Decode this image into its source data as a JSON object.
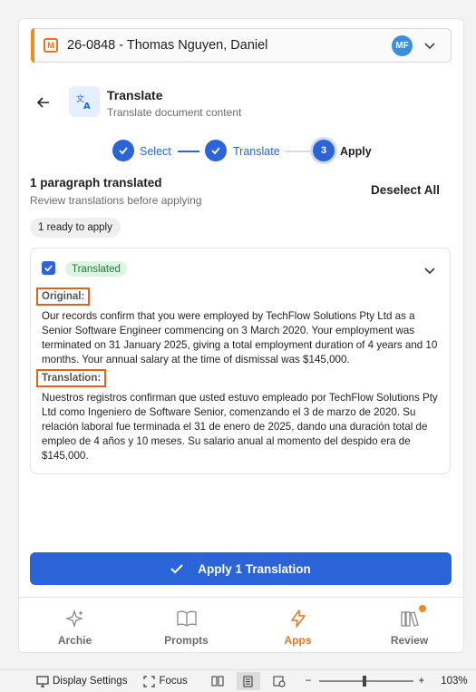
{
  "matter": {
    "title": "26-0848 - Thomas Nguyen, Daniel",
    "avatar_initials": "MF",
    "icon": "matter-icon"
  },
  "header": {
    "title": "Translate",
    "subtitle": "Translate document content"
  },
  "stepper": {
    "steps": [
      {
        "label": "Select"
      },
      {
        "label": "Translate"
      },
      {
        "number": "3",
        "label": "Apply"
      }
    ]
  },
  "summary": {
    "title": "1 paragraph translated",
    "subtitle": "Review translations before applying",
    "deselect_label": "Deselect All",
    "ready_label": "1 ready to apply"
  },
  "card": {
    "badge": "Translated",
    "original_label": "Original:",
    "original_text": "Our records confirm that you were employed by TechFlow Solutions Pty Ltd as a Senior Software Engineer commencing on 3 March 2020. Your employment was terminated on 31 January 2025, giving a total employment duration of 4 years and 10 months. Your annual salary at the time of dismissal was $145,000.",
    "translation_label": "Translation:",
    "translation_text": "Nuestros registros confirman que usted estuvo empleado por TechFlow Solutions Pty Ltd como Ingeniero de Software Senior, comenzando el 3 de marzo de 2020. Su relación laboral fue terminada el 31 de enero de 2025, dando una duración total de empleo de 4 años y 10 meses. Su salario anual al momento del despido era de $145,000."
  },
  "apply_button": {
    "label": "Apply 1 Translation"
  },
  "tabs": [
    {
      "label": "Archie",
      "icon": "sparkle-icon"
    },
    {
      "label": "Prompts",
      "icon": "book-icon"
    },
    {
      "label": "Apps",
      "icon": "lightning-icon"
    },
    {
      "label": "Review",
      "icon": "library-icon"
    }
  ],
  "statusbar": {
    "display_settings": "Display Settings",
    "focus": "Focus",
    "zoom_minus": "−",
    "zoom_plus": "+",
    "zoom": "103%"
  },
  "colors": {
    "accent": "#2b63d8",
    "brand": "#e8741c",
    "success": "#217a3a"
  }
}
